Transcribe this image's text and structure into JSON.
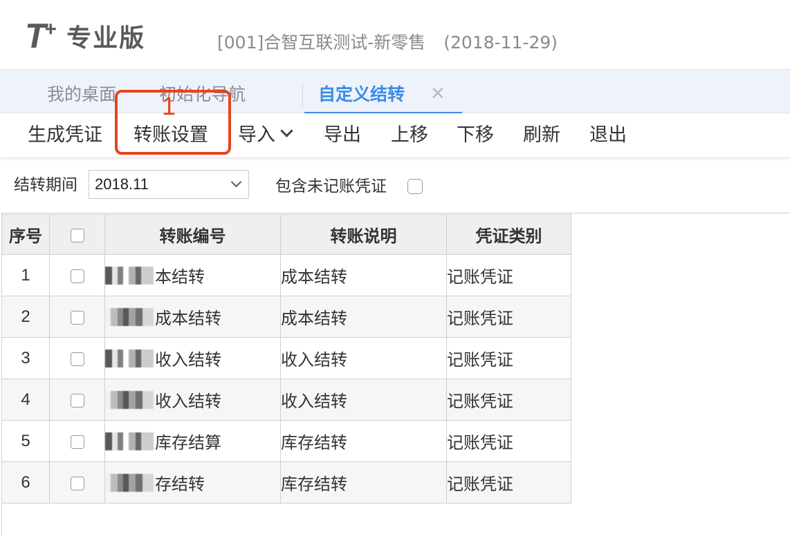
{
  "header": {
    "logo_mark": "T",
    "logo_plus": "+",
    "logo_edition": "专业版",
    "company": "[001]合智互联测试-新零售",
    "date": "(2018-11-29)"
  },
  "tabs": {
    "desktop": "我的桌面",
    "init": "初始化导航",
    "active": "自定义结转",
    "close_glyph": "✕"
  },
  "toolbar": {
    "generate": "生成凭证",
    "settings": "转账设置",
    "import": "导入",
    "export": "导出",
    "move_up": "上移",
    "move_down": "下移",
    "refresh": "刷新",
    "exit": "退出"
  },
  "annotation": {
    "number": "1",
    "color": "#e8431f"
  },
  "filter": {
    "period_label": "结转期间",
    "period_value": "2018.11",
    "unposted_label": "包含未记账凭证",
    "unposted_checked": false
  },
  "grid": {
    "headers": {
      "seq": "序号",
      "code": "转账编号",
      "desc": "转账说明",
      "type": "凭证类别"
    },
    "rows": [
      {
        "seq": "1",
        "code_visible": "本结转",
        "desc": "成本结转",
        "type": "记账凭证"
      },
      {
        "seq": "2",
        "code_visible": "成本结转",
        "desc": "成本结转",
        "type": "记账凭证"
      },
      {
        "seq": "3",
        "code_visible": "收入结转",
        "desc": "收入结转",
        "type": "记账凭证"
      },
      {
        "seq": "4",
        "code_visible": "收入结转",
        "desc": "收入结转",
        "type": "记账凭证"
      },
      {
        "seq": "5",
        "code_visible": "库存结算",
        "desc": "库存结转",
        "type": "记账凭证"
      },
      {
        "seq": "6",
        "code_visible": "存结转",
        "desc": "库存结转",
        "type": "记账凭证"
      }
    ]
  },
  "colors": {
    "accent": "#3a8be8",
    "tabbar_bg": "#eef3fb",
    "highlight": "#e8431f"
  }
}
